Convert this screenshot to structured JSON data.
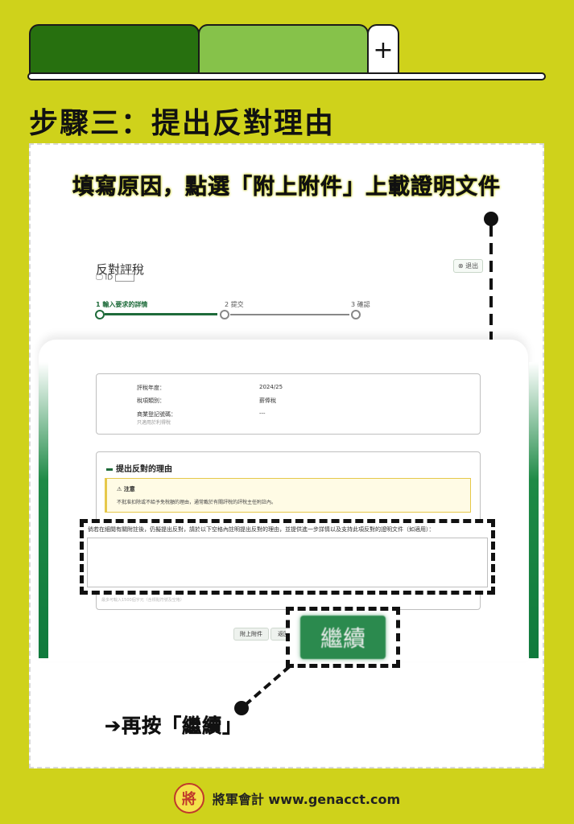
{
  "tabs": {
    "add_tab": "+"
  },
  "page_title": "步驟三：提出反對理由",
  "instruction": "填寫原因，點選「附上附件」上載證明文件",
  "form": {
    "title": "反對評稅",
    "subtitle_prefix": "🖵 ID",
    "exit_label": "⊗ 退出",
    "steps": [
      {
        "label": "1  輸入要求的詳情"
      },
      {
        "label": "2  提交"
      },
      {
        "label": "3  確認"
      }
    ],
    "info": {
      "rows": [
        {
          "label": "評稅年度：",
          "value": "2024/25"
        },
        {
          "label": "稅項類別：",
          "value": "薪俸稅"
        },
        {
          "label": "商業登記號碼：",
          "value": "---"
        }
      ],
      "hint": "只適用於利得稅"
    },
    "reason": {
      "title": "提出反對的理由",
      "notice_title": "⚠ 注意",
      "notice_body": "不批准扣除或不給予免稅額的理由，通常載於有關評稅的評稅主任附註內。",
      "field_label": "倘若在細閱有關附註後，仍擬提出反對，請於以下空格內註明提出反對的理由，並提供進一步詳情以及支持此項反對的證明文件（如適用）：",
      "lower_hint": "最多可輸入1500個字元（含標點符號及空格）"
    },
    "buttons": {
      "attach": "附上附件",
      "back": "返回",
      "continue": "繼續"
    }
  },
  "press_continue": "➔再按「繼續」",
  "footer": {
    "seal_char": "將",
    "text": "將軍會計 www.genacct.com"
  },
  "colors": {
    "background": "#cfd21b",
    "dark_green": "#27700f",
    "light_green": "#86c24a",
    "button_green": "#2b8a4e"
  }
}
